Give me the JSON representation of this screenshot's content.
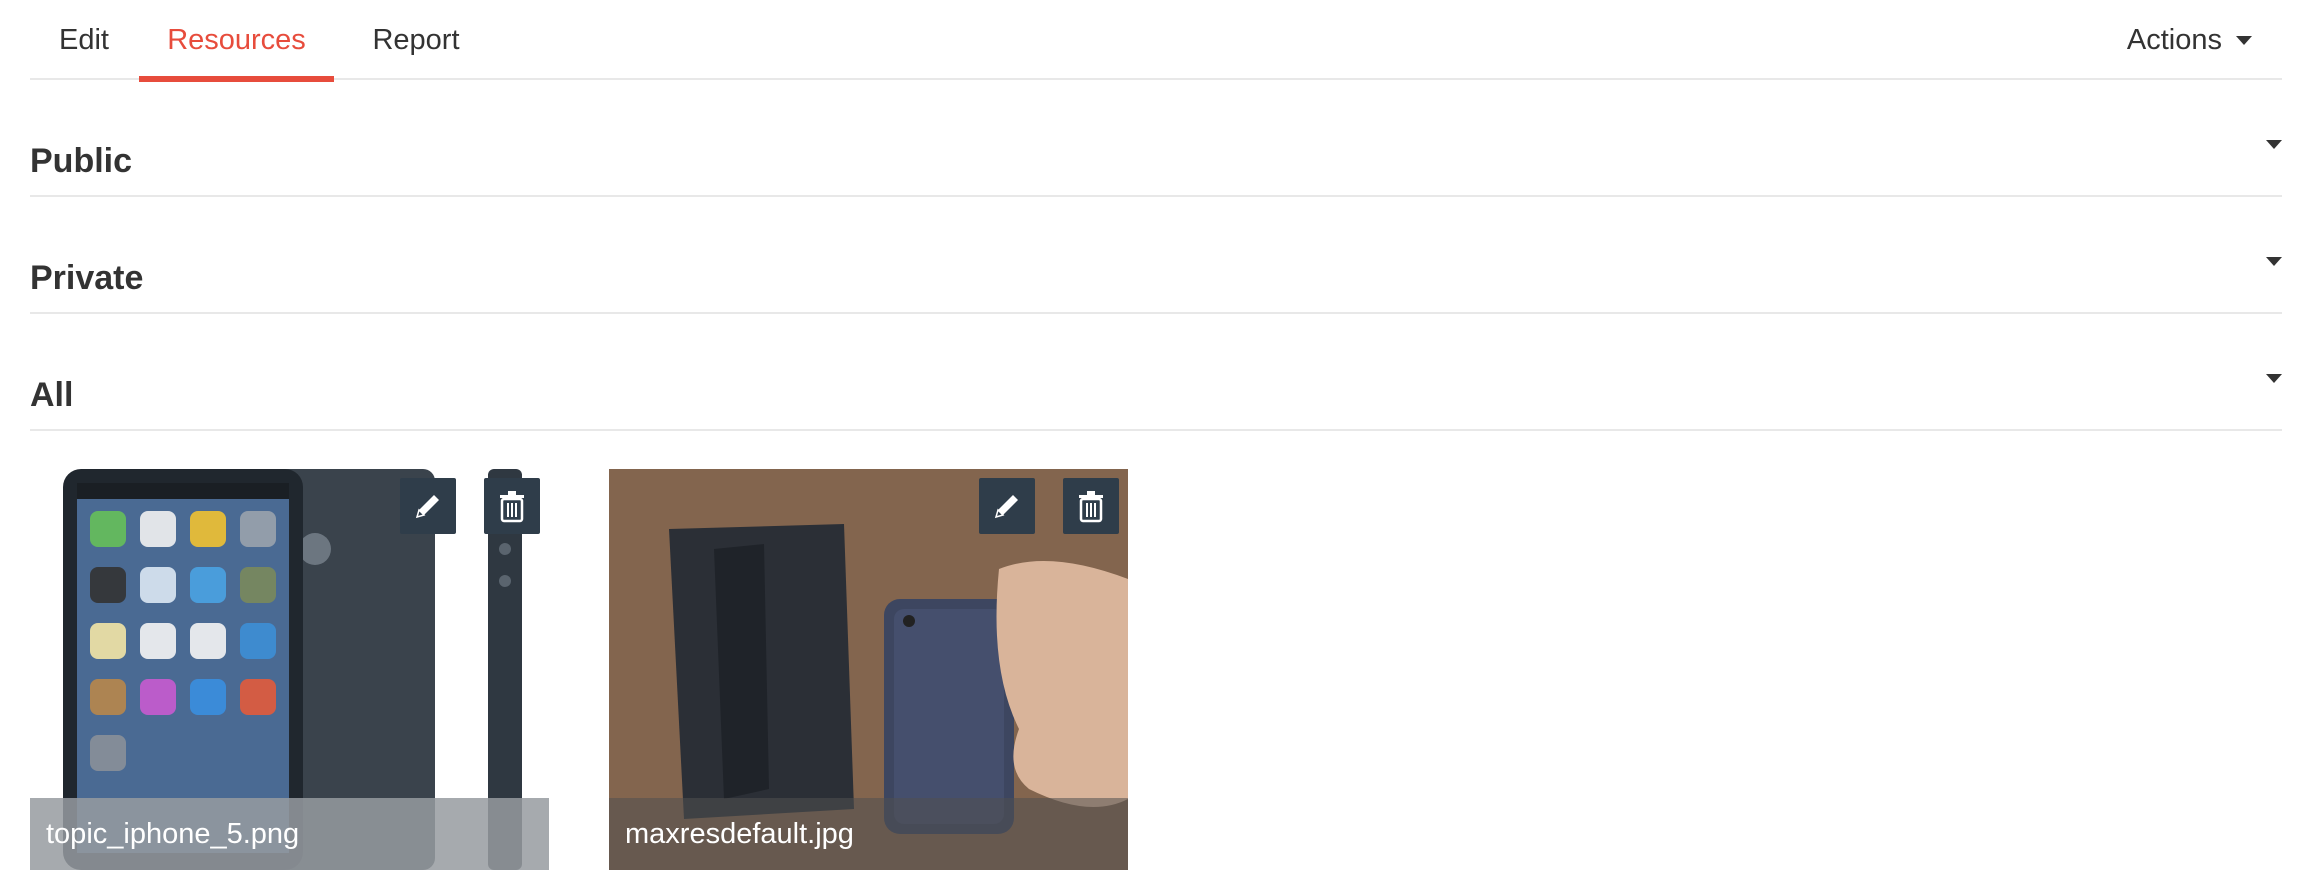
{
  "tabs": [
    {
      "label": "Edit",
      "active": false
    },
    {
      "label": "Resources",
      "active": true
    },
    {
      "label": "Report",
      "active": false
    }
  ],
  "actions": {
    "label": "Actions",
    "icon": "caret-down-icon"
  },
  "sections": [
    {
      "title": "Public",
      "icon": "caret-down-icon"
    },
    {
      "title": "Private",
      "icon": "caret-down-icon"
    },
    {
      "title": "All",
      "icon": "caret-down-icon"
    }
  ],
  "resources": [
    {
      "filename": "topic_iphone_5.png",
      "edit_icon": "pencil-icon",
      "delete_icon": "trash-icon"
    },
    {
      "filename": "maxresdefault.jpg",
      "edit_icon": "pencil-icon",
      "delete_icon": "trash-icon"
    }
  ],
  "colors": {
    "accent": "#e74c3c",
    "text": "#333333",
    "divider": "#e8e8e8",
    "icon_button_bg": "#2f3d4a"
  }
}
